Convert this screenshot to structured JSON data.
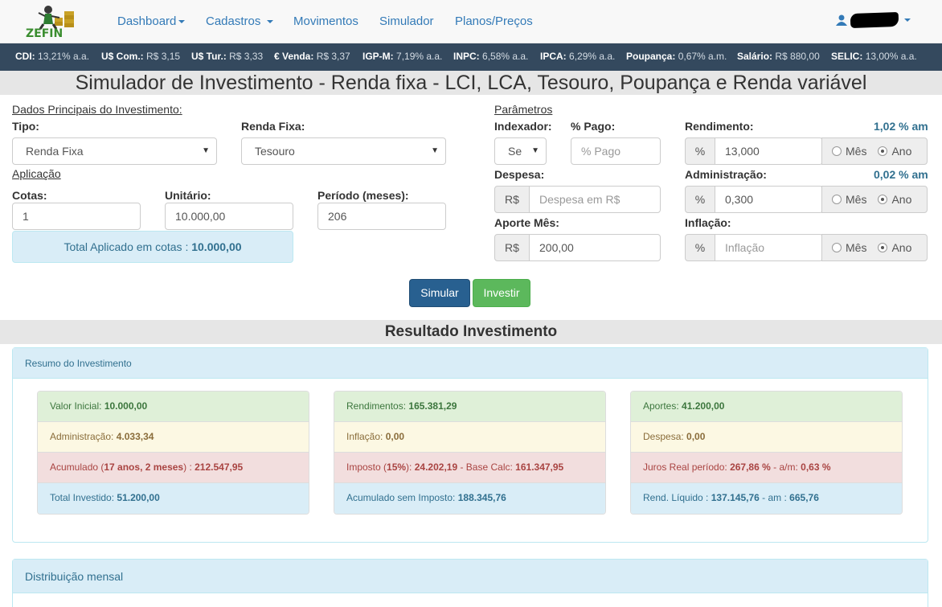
{
  "brand": {
    "name": "ZEFIN"
  },
  "nav": {
    "dashboard": "Dashboard",
    "cadastros": "Cadastros",
    "movimentos": "Movimentos",
    "simulador": "Simulador",
    "planos": "Planos/Preços"
  },
  "indices": [
    {
      "label": "CDI:",
      "value": "13,21% a.a."
    },
    {
      "label": "U$ Com.:",
      "value": "R$ 3,15"
    },
    {
      "label": "U$ Tur.:",
      "value": "R$ 3,33"
    },
    {
      "label": "€ Venda:",
      "value": "R$ 3,37"
    },
    {
      "label": "IGP-M:",
      "value": "7,19% a.a."
    },
    {
      "label": "INPC:",
      "value": "6,58% a.a."
    },
    {
      "label": "IPCA:",
      "value": "6,29% a.a."
    },
    {
      "label": "Poupança:",
      "value": "0,67% a.m."
    },
    {
      "label": "Salário:",
      "value": "R$ 880,00"
    },
    {
      "label": "SELIC:",
      "value": "13,00% a.a."
    }
  ],
  "title": "Simulador de Investimento - Renda fixa - LCI, LCA, Tesouro, Poupança e Renda variável",
  "principal": {
    "heading": "Dados Principais do Investimento:",
    "tipo_label": "Tipo:",
    "tipo_value": "Renda Fixa",
    "renda_label": "Renda Fixa:",
    "renda_value": "Tesouro",
    "aplicacao_heading": "Aplicação",
    "cotas_label": "Cotas:",
    "cotas_value": "1",
    "unitario_label": "Unitário:",
    "unitario_value": "10.000,00",
    "periodo_label": "Período (meses):",
    "periodo_value": "206",
    "total_prefix": "Total Aplicado em cotas :",
    "total_value": "10.000,00"
  },
  "params": {
    "heading": "Parâmetros",
    "indexador_label": "Indexador:",
    "indexador_value": "Se",
    "pago_label": "% Pago:",
    "pago_placeholder": "% Pago",
    "rendimento_label": "Rendimento:",
    "rendimento_rate": "1,02 % am",
    "rendimento_addon": "%",
    "rendimento_value": "13,000",
    "despesa_label": "Despesa:",
    "despesa_addon": "R$",
    "despesa_placeholder": "Despesa em R$",
    "admin_label": "Administração:",
    "admin_rate": "0,02 % am",
    "admin_addon": "%",
    "admin_value": "0,300",
    "aporte_label": "Aporte Mês:",
    "aporte_addon": "R$",
    "aporte_value": "200,00",
    "inflacao_label": "Inflação:",
    "inflacao_addon": "%",
    "inflacao_placeholder": "Inflação",
    "mes": "Mês",
    "ano": "Ano"
  },
  "buttons": {
    "simular": "Simular",
    "investir": "Investir"
  },
  "result": {
    "heading": "Resultado Investimento",
    "panel_title": "Resumo do Investimento",
    "col1": {
      "valor_inicial_label": "Valor Inicial:",
      "valor_inicial": "10.000,00",
      "admin_label": "Administração:",
      "admin": "4.033,34",
      "acum_label": "Acumulado (",
      "acum_period": "17 anos, 2 meses",
      "acum_sep": ") :",
      "acum": "212.547,95",
      "total_label": "Total Investido:",
      "total": "51.200,00"
    },
    "col2": {
      "rend_label": "Rendimentos:",
      "rend": "165.381,29",
      "infl_label": "Inflação:",
      "infl": "0,00",
      "imposto_label": "Imposto (",
      "imposto_pct": "15%",
      "imposto_sep": "):",
      "imposto": "24.202,19",
      "base_label": "- Base Calc:",
      "base": "161.347,95",
      "acum_si_label": "Acumulado sem Imposto:",
      "acum_si": "188.345,76"
    },
    "col3": {
      "aportes_label": "Aportes:",
      "aportes": "41.200,00",
      "despesa_label": "Despesa:",
      "despesa": "0,00",
      "juros_label": "Juros Real período:",
      "juros": "267,86 %",
      "juros_am_label": "- a/m:",
      "juros_am": "0,63 %",
      "liq_label": "Rend. Líquido :",
      "liq": "137.145,76",
      "liq_am_label": "- am :",
      "liq_am": "665,76"
    },
    "dist_title": "Distribuição mensal"
  }
}
